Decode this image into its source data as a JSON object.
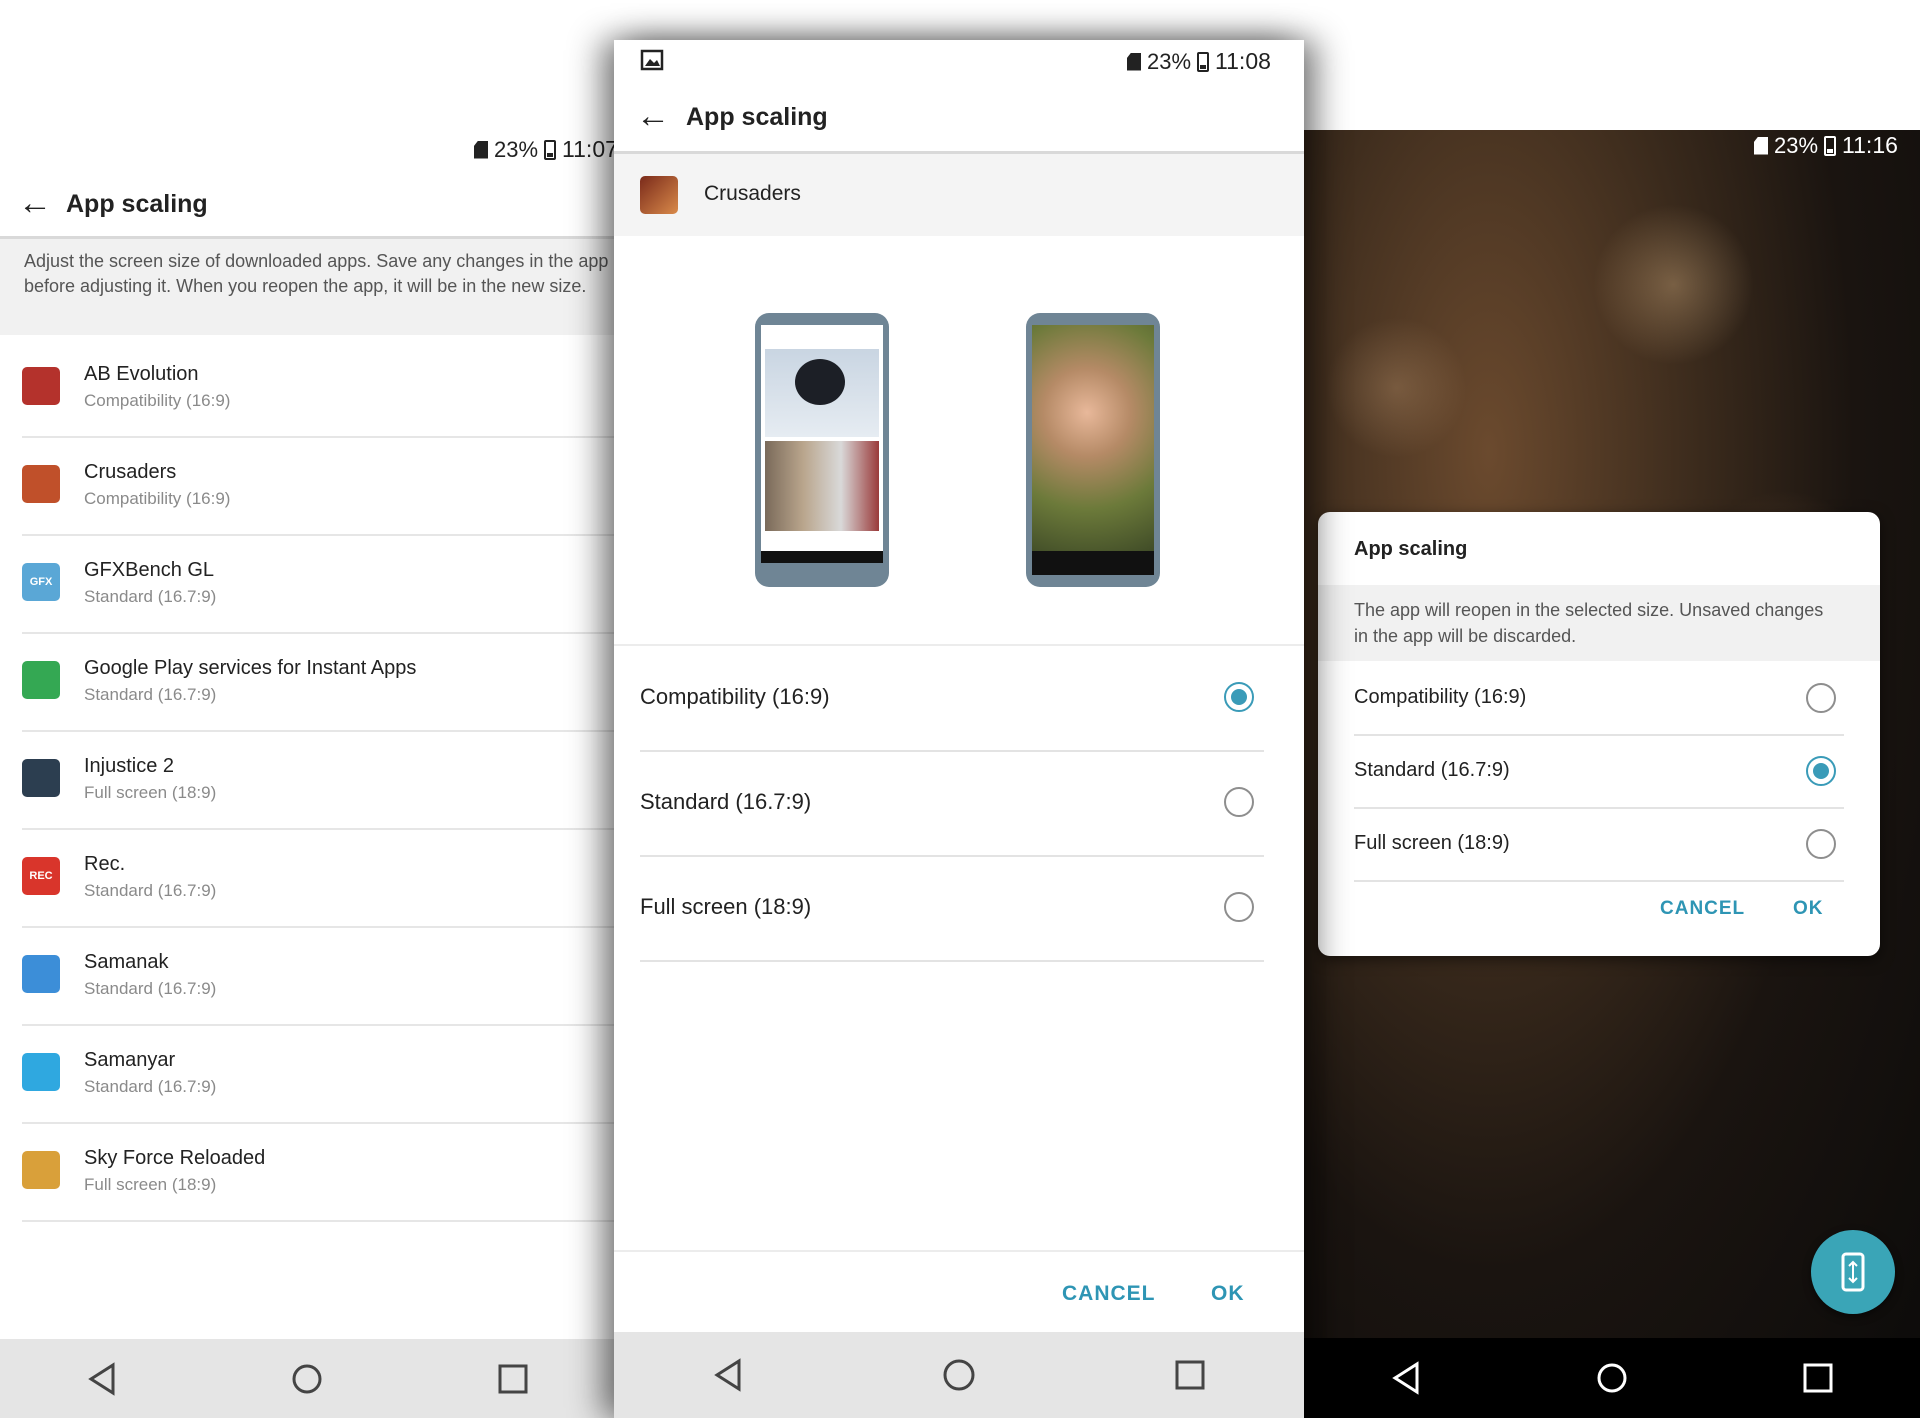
{
  "left": {
    "status": {
      "battery": "23%",
      "time": "11:07"
    },
    "title": "App scaling",
    "description": "Adjust the screen size of downloaded apps. Save any changes in the app before adjusting it. When you reopen the app, it will be in the new size.",
    "apps": [
      {
        "name": "AB Evolution",
        "mode": "Compatibility (16:9)",
        "color": "#b4322c"
      },
      {
        "name": "Crusaders",
        "mode": "Compatibility (16:9)",
        "color": "#c0502a"
      },
      {
        "name": "GFXBench GL",
        "mode": "Standard (16.7:9)",
        "color": "#5aa7d6",
        "icon_text": "GFX"
      },
      {
        "name": "Google Play services for Instant Apps",
        "mode": "Standard (16.7:9)",
        "color": "#34a853"
      },
      {
        "name": "Injustice 2",
        "mode": "Full screen (18:9)",
        "color": "#2c3e50"
      },
      {
        "name": "Rec.",
        "mode": "Standard (16.7:9)",
        "color": "#d9352b",
        "icon_text": "REC"
      },
      {
        "name": "Samanak",
        "mode": "Standard (16.7:9)",
        "color": "#3c8ed8"
      },
      {
        "name": "Samanyar",
        "mode": "Standard (16.7:9)",
        "color": "#2fa8e0"
      },
      {
        "name": "Sky Force Reloaded",
        "mode": "Full screen (18:9)",
        "color": "#d9a03a"
      }
    ]
  },
  "middle": {
    "status": {
      "battery": "23%",
      "time": "11:08"
    },
    "title": "App scaling",
    "app_name": "Crusaders",
    "options": [
      {
        "label": "Compatibility (16:9)",
        "selected": true
      },
      {
        "label": "Standard (16.7:9)",
        "selected": false
      },
      {
        "label": "Full screen (18:9)",
        "selected": false
      }
    ],
    "cancel_label": "CANCEL",
    "ok_label": "OK"
  },
  "right": {
    "status": {
      "battery": "23%",
      "time": "11:16"
    },
    "dialog": {
      "title": "App scaling",
      "message": "The app will reopen in the selected size. Unsaved changes in the app will be discarded.",
      "options": [
        {
          "label": "Compatibility (16:9)",
          "selected": false
        },
        {
          "label": "Standard (16.7:9)",
          "selected": true
        },
        {
          "label": "Full screen (18:9)",
          "selected": false
        }
      ],
      "cancel_label": "CANCEL",
      "ok_label": "OK"
    }
  },
  "colors": {
    "accent": "#3a9bb8",
    "fab": "#3aa5b7"
  }
}
